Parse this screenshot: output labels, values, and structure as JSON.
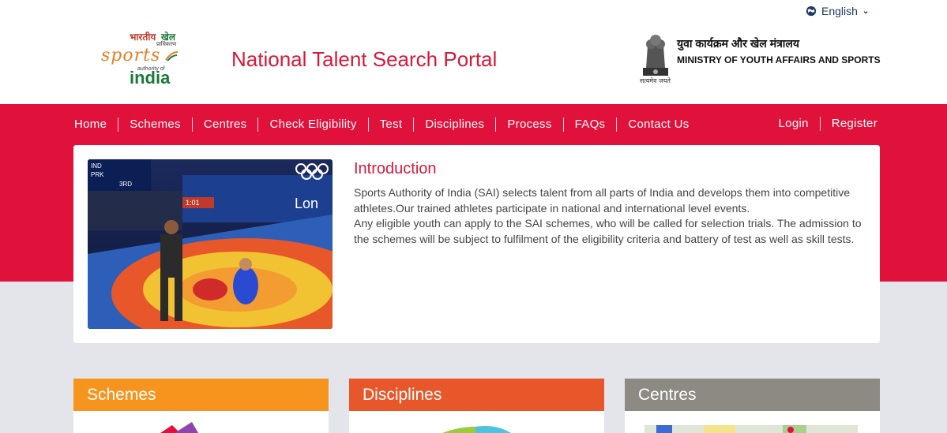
{
  "header": {
    "language": "English",
    "logo": {
      "hindi_left": "भारतीय",
      "hindi_right": "खेल",
      "hindi_sub": "प्राधिकरण",
      "sports": "sports",
      "authority_of": "authority of",
      "india": "india"
    },
    "portal_title": "National Talent Search Portal",
    "emblem_caption": "सत्यमेव जयते",
    "ministry_hindi": "युवा कार्यक्रम और खेल मंत्रालय",
    "ministry_english": "MINISTRY OF YOUTH AFFAIRS AND SPORTS"
  },
  "nav": {
    "items": [
      "Home",
      "Schemes",
      "Centres",
      "Check Eligibility",
      "Test",
      "Disciplines",
      "Process",
      "FAQs",
      "Contact Us"
    ],
    "login": "Login",
    "register": "Register"
  },
  "intro": {
    "title": "Introduction",
    "paragraph1": "Sports Authority of India (SAI) selects talent from all parts of India and develops them into competitive athletes.Our trained athletes participate in national and international level events.",
    "paragraph2": "Any eligible youth can apply to the SAI schemes, who will be called for selection trials. The admission to the schemes will be subject to fulfilment of the eligibility criteria and battery of test as well as skill tests.",
    "image_scoreboard": {
      "row1": "IND",
      "row2": "PRK",
      "period": "3RD",
      "clock": "1:01",
      "venue_text": "Lon"
    }
  },
  "tiles": {
    "schemes": "Schemes",
    "disciplines": "Disciplines",
    "centres": "Centres"
  },
  "colors": {
    "brand_red": "#e0113a",
    "title_red": "#d6193a",
    "schemes_orange": "#f7941d",
    "disciplines_orange": "#e8572a",
    "centres_grey": "#8d8983"
  }
}
